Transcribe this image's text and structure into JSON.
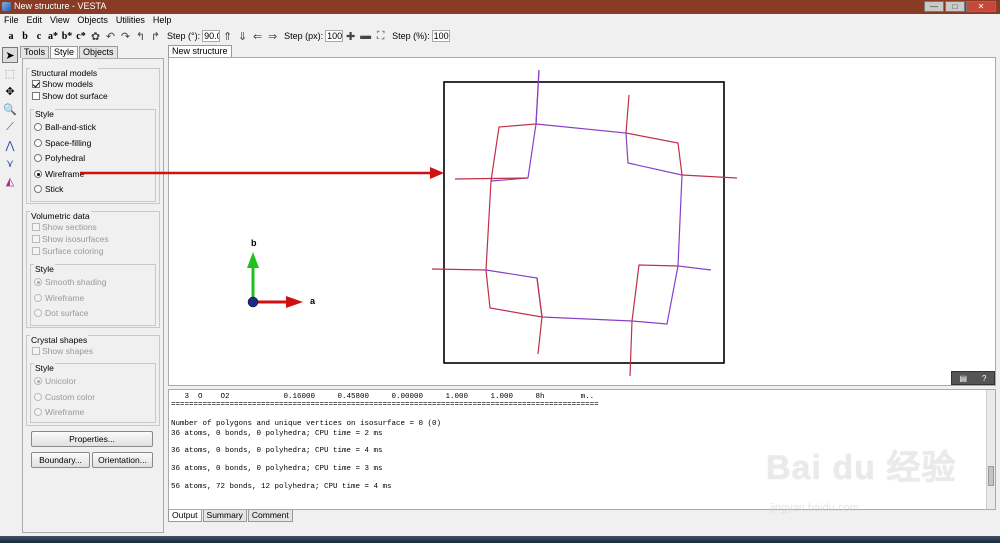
{
  "window": {
    "title": "New structure - VESTA",
    "btn_min": "—",
    "btn_max": "□",
    "btn_close": "✕"
  },
  "menu": [
    "File",
    "Edit",
    "View",
    "Objects",
    "Utilities",
    "Help"
  ],
  "toolbar": {
    "axes": [
      "a",
      "b",
      "c",
      "a*",
      "b*",
      "c*"
    ],
    "step_deg_label": "Step (°):",
    "step_deg_value": "90.0",
    "step_px_label": "Step (px):",
    "step_px_value": "100",
    "step_pct_label": "Step (%):",
    "step_pct_value": "100"
  },
  "panel": {
    "tabs": [
      "Tools",
      "Style",
      "Objects"
    ],
    "structural": {
      "title": "Structural models",
      "show_models": "Show models",
      "show_dot_surface": "Show dot surface",
      "style_title": "Style",
      "styles": [
        "Ball-and-stick",
        "Space-filling",
        "Polyhedral",
        "Wireframe",
        "Stick"
      ],
      "selected": "Wireframe"
    },
    "volumetric": {
      "title": "Volumetric data",
      "show_sections": "Show sections",
      "show_isosurfaces": "Show isosurfaces",
      "surface_coloring": "Surface coloring",
      "style_title": "Style",
      "styles": [
        "Smooth shading",
        "Wireframe",
        "Dot surface"
      ]
    },
    "crystal": {
      "title": "Crystal shapes",
      "show_shapes": "Show shapes",
      "style_title": "Style",
      "styles": [
        "Unicolor",
        "Custom color",
        "Wireframe"
      ]
    },
    "buttons": {
      "properties": "Properties...",
      "boundary": "Boundary...",
      "orientation": "Orientation..."
    }
  },
  "viewport": {
    "tab": "New structure",
    "axis_b": "b",
    "axis_a": "a",
    "corner_help": "?"
  },
  "output": {
    "lines": [
      "   3  O    O2            0.16000     0.45800     0.00000     1.000     1.000     8h        m..",
      "===============================================================================================",
      "",
      "Number of polygons and unique vertices on isosurface = 0 (0)",
      "36 atoms, 0 bonds, 0 polyhedra; CPU time = 2 ms",
      "",
      "36 atoms, 0 bonds, 0 polyhedra; CPU time = 4 ms",
      "",
      "36 atoms, 0 bonds, 0 polyhedra; CPU time = 3 ms",
      "",
      "56 atoms, 72 bonds, 12 polyhedra; CPU time = 4 ms"
    ],
    "tabs": [
      "Output",
      "Summary",
      "Comment"
    ]
  },
  "watermark": {
    "brand": "Bai du 经验",
    "url": "jingyan.baidu.com"
  },
  "colors": {
    "titlebar": "#8a3b26",
    "wire_red": "#c0304a",
    "wire_purple": "#8a3fc8",
    "annotation_arrow": "#d01010",
    "axis_b": "#21c021",
    "axis_a": "#d01010"
  }
}
